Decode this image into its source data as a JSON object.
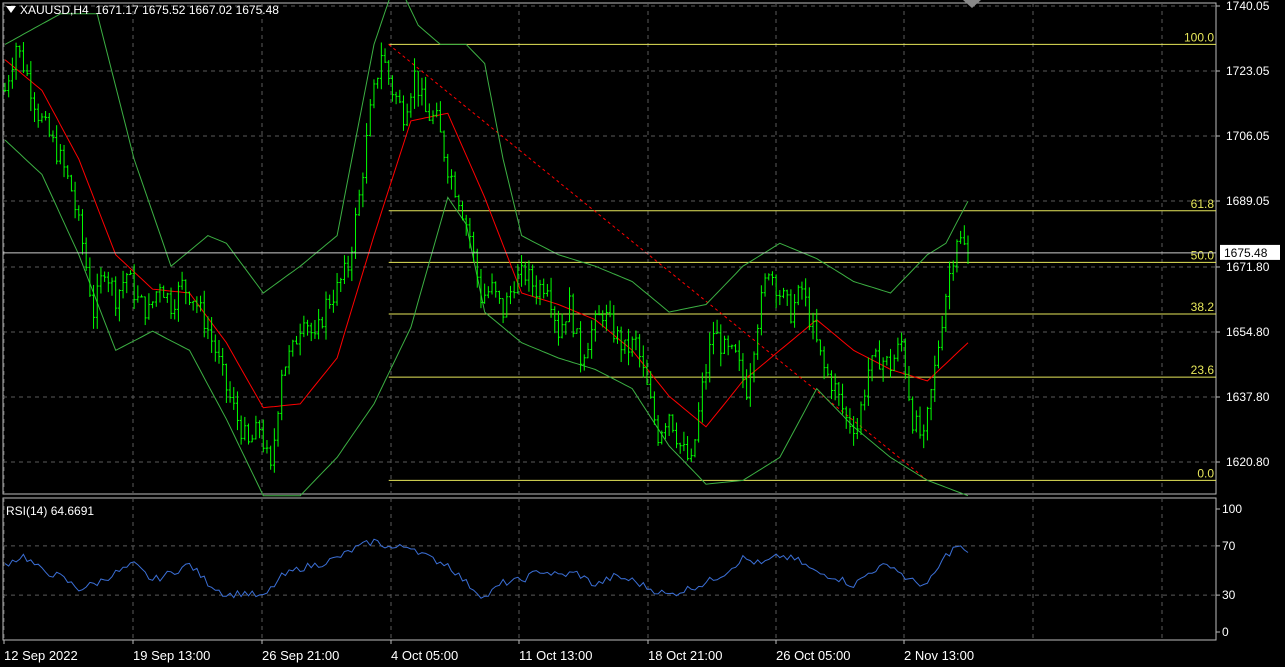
{
  "header": {
    "symbol": "XAUUSD,H4",
    "open": "1671.17",
    "high": "1675.52",
    "low": "1667.02",
    "close": "1675.48"
  },
  "rsi_header": {
    "label": "RSI(14)",
    "value": "64.6691"
  },
  "colors": {
    "background": "#000000",
    "grid": "#5a5a5a",
    "candle": "#00ff00",
    "bollinger": "#3cb043",
    "moving_average": "#ff0000",
    "fibonacci": "#e6e65a",
    "trendline": "#ff0000",
    "rsi_line": "#3b6fd6",
    "price_label_bg": "#ffffff"
  },
  "chart_data": [
    {
      "type": "candlestick",
      "symbol": "XAUUSD",
      "timeframe": "H4",
      "y_ticks": [
        "1740.05",
        "1723.05",
        "1706.05",
        "1689.05",
        "1671.80",
        "1654.80",
        "1637.80",
        "1620.80"
      ],
      "ylim": [
        1613,
        1741
      ],
      "x_ticks": [
        "12 Sep 2022",
        "19 Sep 13:00",
        "26 Sep 21:00",
        "4 Oct 05:00",
        "11 Oct 13:00",
        "18 Oct 21:00",
        "26 Oct 05:00",
        "2 Nov 13:00"
      ],
      "current_price": "1675.48",
      "close_path": [
        [
          0,
          1718
        ],
        [
          3,
          1730
        ],
        [
          6,
          1722
        ],
        [
          9,
          1712
        ],
        [
          12,
          1706
        ],
        [
          15,
          1700
        ],
        [
          18,
          1692
        ],
        [
          21,
          1678
        ],
        [
          24,
          1660
        ],
        [
          27,
          1672
        ],
        [
          30,
          1664
        ],
        [
          33,
          1670
        ],
        [
          36,
          1663
        ],
        [
          39,
          1660
        ],
        [
          42,
          1668
        ],
        [
          45,
          1662
        ],
        [
          48,
          1667
        ],
        [
          51,
          1664
        ],
        [
          54,
          1658
        ],
        [
          57,
          1650
        ],
        [
          60,
          1640
        ],
        [
          63,
          1632
        ],
        [
          66,
          1625
        ],
        [
          69,
          1630
        ],
        [
          72,
          1618
        ],
        [
          75,
          1645
        ],
        [
          78,
          1650
        ],
        [
          81,
          1660
        ],
        [
          84,
          1652
        ],
        [
          87,
          1662
        ],
        [
          90,
          1666
        ],
        [
          93,
          1672
        ],
        [
          96,
          1690
        ],
        [
          99,
          1712
        ],
        [
          102,
          1728
        ],
        [
          105,
          1718
        ],
        [
          108,
          1712
        ],
        [
          111,
          1722
        ],
        [
          114,
          1712
        ],
        [
          117,
          1710
        ],
        [
          120,
          1698
        ],
        [
          123,
          1690
        ],
        [
          126,
          1680
        ],
        [
          129,
          1664
        ],
        [
          132,
          1666
        ],
        [
          135,
          1660
        ],
        [
          138,
          1668
        ],
        [
          141,
          1670
        ],
        [
          144,
          1666
        ],
        [
          147,
          1668
        ],
        [
          150,
          1655
        ],
        [
          153,
          1662
        ],
        [
          156,
          1648
        ],
        [
          159,
          1655
        ],
        [
          162,
          1660
        ],
        [
          165,
          1655
        ],
        [
          168,
          1650
        ],
        [
          171,
          1652
        ],
        [
          174,
          1640
        ],
        [
          177,
          1628
        ],
        [
          180,
          1634
        ],
        [
          183,
          1625
        ],
        [
          186,
          1620
        ],
        [
          189,
          1640
        ],
        [
          192,
          1655
        ],
        [
          195,
          1650
        ],
        [
          198,
          1648
        ],
        [
          201,
          1640
        ],
        [
          204,
          1658
        ],
        [
          207,
          1672
        ],
        [
          210,
          1665
        ],
        [
          213,
          1660
        ],
        [
          216,
          1666
        ],
        [
          219,
          1655
        ],
        [
          222,
          1645
        ],
        [
          225,
          1640
        ],
        [
          228,
          1632
        ],
        [
          231,
          1630
        ],
        [
          234,
          1645
        ],
        [
          237,
          1648
        ],
        [
          240,
          1646
        ],
        [
          243,
          1652
        ],
        [
          246,
          1632
        ],
        [
          249,
          1626
        ],
        [
          252,
          1645
        ],
        [
          255,
          1665
        ],
        [
          258,
          1680
        ],
        [
          261,
          1675.48
        ]
      ],
      "bollinger_upper_path": [
        [
          0,
          1730
        ],
        [
          15,
          1738
        ],
        [
          25,
          1738
        ],
        [
          35,
          1700
        ],
        [
          45,
          1672
        ],
        [
          55,
          1680
        ],
        [
          60,
          1678
        ],
        [
          70,
          1665
        ],
        [
          80,
          1672
        ],
        [
          90,
          1680
        ],
        [
          100,
          1730
        ],
        [
          106,
          1747
        ],
        [
          112,
          1735
        ],
        [
          118,
          1730
        ],
        [
          125,
          1730
        ],
        [
          130,
          1725
        ],
        [
          135,
          1700
        ],
        [
          140,
          1680
        ],
        [
          150,
          1675
        ],
        [
          160,
          1672
        ],
        [
          170,
          1668
        ],
        [
          180,
          1660
        ],
        [
          190,
          1662
        ],
        [
          200,
          1672
        ],
        [
          210,
          1678
        ],
        [
          220,
          1674
        ],
        [
          230,
          1668
        ],
        [
          240,
          1665
        ],
        [
          250,
          1675
        ],
        [
          255,
          1678
        ],
        [
          261,
          1689
        ]
      ],
      "bollinger_lower_path": [
        [
          0,
          1705
        ],
        [
          10,
          1696
        ],
        [
          20,
          1675
        ],
        [
          30,
          1650
        ],
        [
          40,
          1655
        ],
        [
          50,
          1650
        ],
        [
          60,
          1632
        ],
        [
          70,
          1612
        ],
        [
          80,
          1612
        ],
        [
          90,
          1622
        ],
        [
          100,
          1636
        ],
        [
          110,
          1656
        ],
        [
          120,
          1690
        ],
        [
          125,
          1683
        ],
        [
          130,
          1660
        ],
        [
          140,
          1652
        ],
        [
          150,
          1648
        ],
        [
          160,
          1645
        ],
        [
          170,
          1640
        ],
        [
          180,
          1625
        ],
        [
          190,
          1615
        ],
        [
          200,
          1616
        ],
        [
          210,
          1622
        ],
        [
          220,
          1640
        ],
        [
          230,
          1630
        ],
        [
          240,
          1622
        ],
        [
          250,
          1616
        ],
        [
          261,
          1612
        ]
      ],
      "moving_average_path": [
        [
          0,
          1726
        ],
        [
          10,
          1718
        ],
        [
          20,
          1700
        ],
        [
          30,
          1675
        ],
        [
          40,
          1666
        ],
        [
          50,
          1665
        ],
        [
          60,
          1652
        ],
        [
          70,
          1635
        ],
        [
          80,
          1636
        ],
        [
          90,
          1648
        ],
        [
          100,
          1680
        ],
        [
          110,
          1710
        ],
        [
          120,
          1712
        ],
        [
          130,
          1690
        ],
        [
          140,
          1665
        ],
        [
          150,
          1662
        ],
        [
          160,
          1658
        ],
        [
          170,
          1650
        ],
        [
          180,
          1638
        ],
        [
          190,
          1630
        ],
        [
          200,
          1642
        ],
        [
          210,
          1650
        ],
        [
          220,
          1658
        ],
        [
          230,
          1650
        ],
        [
          240,
          1645
        ],
        [
          250,
          1642
        ],
        [
          261,
          1652
        ]
      ],
      "fibonacci": {
        "high": 1730,
        "low": 1616,
        "levels": [
          {
            "label": "100.0",
            "value": 1730
          },
          {
            "label": "61.8",
            "value": 1686.5
          },
          {
            "label": "50.0",
            "value": 1673
          },
          {
            "label": "38.2",
            "value": 1659.5
          },
          {
            "label": "23.6",
            "value": 1643
          },
          {
            "label": "0.0",
            "value": 1616
          }
        ]
      },
      "trendline": {
        "from": [
          104,
          1730
        ],
        "to": [
          250,
          1616
        ],
        "style": "dashed"
      }
    },
    {
      "type": "line",
      "title": "RSI(14)",
      "y_ticks": [
        "100",
        "70",
        "30",
        "0"
      ],
      "ylim": [
        0,
        100
      ],
      "levels": [
        70,
        30
      ],
      "last_value": 64.6691,
      "values_path": [
        [
          0,
          55
        ],
        [
          5,
          62
        ],
        [
          10,
          50
        ],
        [
          15,
          45
        ],
        [
          20,
          35
        ],
        [
          25,
          40
        ],
        [
          30,
          48
        ],
        [
          35,
          55
        ],
        [
          40,
          42
        ],
        [
          45,
          48
        ],
        [
          50,
          55
        ],
        [
          55,
          40
        ],
        [
          60,
          30
        ],
        [
          65,
          32
        ],
        [
          70,
          28
        ],
        [
          75,
          45
        ],
        [
          80,
          52
        ],
        [
          85,
          55
        ],
        [
          90,
          60
        ],
        [
          95,
          68
        ],
        [
          100,
          74
        ],
        [
          105,
          68
        ],
        [
          110,
          70
        ],
        [
          115,
          60
        ],
        [
          120,
          55
        ],
        [
          125,
          40
        ],
        [
          130,
          28
        ],
        [
          135,
          40
        ],
        [
          140,
          42
        ],
        [
          145,
          50
        ],
        [
          150,
          46
        ],
        [
          155,
          48
        ],
        [
          160,
          38
        ],
        [
          165,
          45
        ],
        [
          170,
          42
        ],
        [
          175,
          35
        ],
        [
          180,
          30
        ],
        [
          185,
          35
        ],
        [
          190,
          40
        ],
        [
          195,
          48
        ],
        [
          200,
          60
        ],
        [
          205,
          55
        ],
        [
          210,
          62
        ],
        [
          215,
          58
        ],
        [
          220,
          48
        ],
        [
          225,
          45
        ],
        [
          230,
          38
        ],
        [
          235,
          50
        ],
        [
          240,
          55
        ],
        [
          245,
          42
        ],
        [
          250,
          38
        ],
        [
          255,
          62
        ],
        [
          258,
          70
        ],
        [
          261,
          64.67
        ]
      ]
    }
  ]
}
